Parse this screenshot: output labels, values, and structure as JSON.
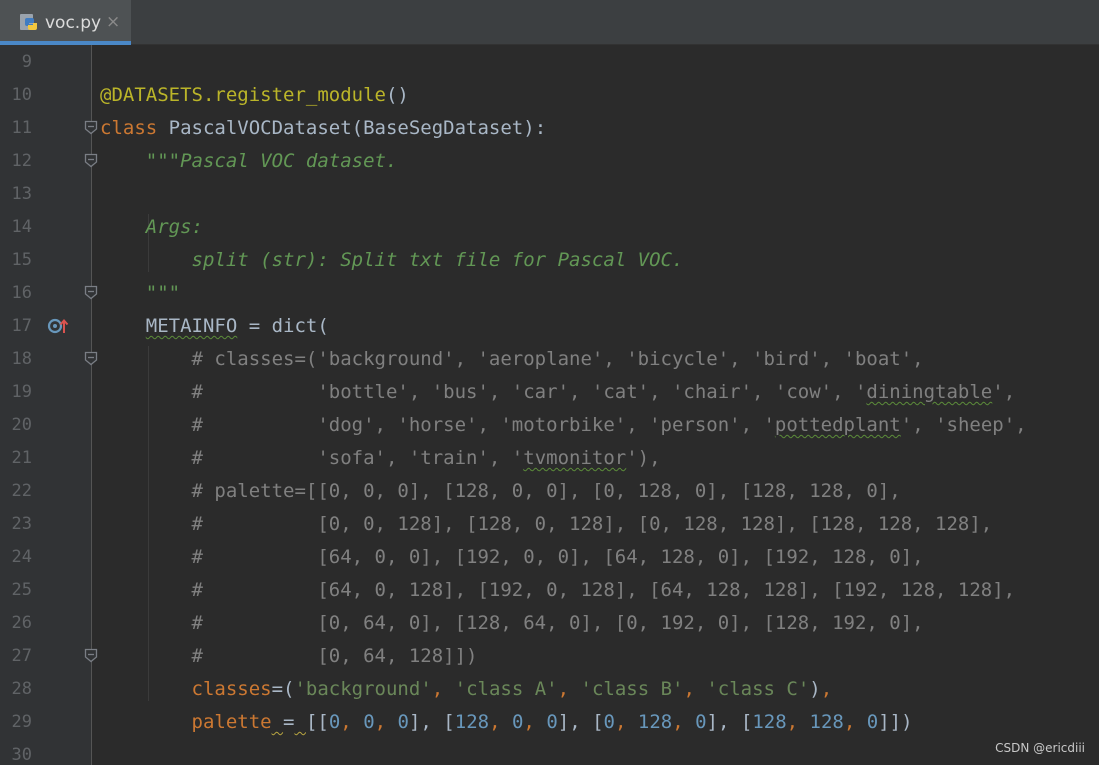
{
  "tab": {
    "title": "voc.py",
    "close_symbol": "×",
    "icon": "python-file-icon"
  },
  "watermark": "CSDN @ericdiii",
  "colors": {
    "background": "#2b2b2b",
    "gutter": "#313335",
    "keyword": "#cc7832",
    "decorator": "#bbb529",
    "docstring": "#629755",
    "comment": "#808080",
    "string": "#6a8759",
    "number": "#6897bb",
    "accent_tab_underline": "#4a88c7"
  },
  "gutter_icons": {
    "line_17": "override-implements-icon"
  },
  "lines": [
    {
      "num": "9",
      "fold": false,
      "tokens": []
    },
    {
      "num": "10",
      "fold": false,
      "tokens": [
        {
          "t": "@DATASETS.register_module",
          "c": "dec"
        },
        {
          "t": "()",
          "c": "plain"
        }
      ]
    },
    {
      "num": "11",
      "fold": true,
      "tokens": [
        {
          "t": "class ",
          "c": "kw"
        },
        {
          "t": "PascalVOCDataset(BaseSegDataset):",
          "c": "plain"
        }
      ]
    },
    {
      "num": "12",
      "fold": true,
      "tokens": [
        {
          "t": "    ",
          "c": "plain"
        },
        {
          "t": "\"\"\"Pascal VOC dataset.",
          "c": "doc"
        }
      ]
    },
    {
      "num": "13",
      "fold": false,
      "tokens": []
    },
    {
      "num": "14",
      "fold": false,
      "tokens": [
        {
          "t": "    ",
          "c": "plain"
        },
        {
          "t": "Args:",
          "c": "doc"
        }
      ]
    },
    {
      "num": "15",
      "fold": false,
      "tokens": [
        {
          "t": "        ",
          "c": "plain"
        },
        {
          "t": "split (str): Split txt file for Pascal VOC.",
          "c": "doc"
        }
      ]
    },
    {
      "num": "16",
      "fold": true,
      "tokens": [
        {
          "t": "    ",
          "c": "plain"
        },
        {
          "t": "\"\"\"",
          "c": "doc"
        }
      ]
    },
    {
      "num": "17",
      "fold": false,
      "mark": true,
      "tokens": [
        {
          "t": "    ",
          "c": "plain"
        },
        {
          "t": "METAINFO",
          "c": "plain",
          "sq": "green"
        },
        {
          "t": " = dict(",
          "c": "plain"
        }
      ]
    },
    {
      "num": "18",
      "fold": true,
      "tokens": [
        {
          "t": "        ",
          "c": "plain"
        },
        {
          "t": "# classes=('background', 'aeroplane', 'bicycle', 'bird', 'boat',",
          "c": "cm"
        }
      ]
    },
    {
      "num": "19",
      "fold": false,
      "tokens": [
        {
          "t": "        ",
          "c": "plain"
        },
        {
          "t": "#          'bottle', 'bus', 'car', 'cat', 'chair', 'cow', '",
          "c": "cm"
        },
        {
          "t": "diningtable",
          "c": "cm",
          "sq": "green"
        },
        {
          "t": "',",
          "c": "cm"
        }
      ]
    },
    {
      "num": "20",
      "fold": false,
      "tokens": [
        {
          "t": "        ",
          "c": "plain"
        },
        {
          "t": "#          'dog', 'horse', 'motorbike', 'person', '",
          "c": "cm"
        },
        {
          "t": "pottedplant",
          "c": "cm",
          "sq": "green"
        },
        {
          "t": "', 'sheep',",
          "c": "cm"
        }
      ]
    },
    {
      "num": "21",
      "fold": false,
      "tokens": [
        {
          "t": "        ",
          "c": "plain"
        },
        {
          "t": "#          'sofa', 'train', '",
          "c": "cm"
        },
        {
          "t": "tvmonitor",
          "c": "cm",
          "sq": "green"
        },
        {
          "t": "'),",
          "c": "cm"
        }
      ]
    },
    {
      "num": "22",
      "fold": false,
      "tokens": [
        {
          "t": "        ",
          "c": "plain"
        },
        {
          "t": "# palette=[[0, 0, 0], [128, 0, 0], [0, 128, 0], [128, 128, 0],",
          "c": "cm"
        }
      ]
    },
    {
      "num": "23",
      "fold": false,
      "tokens": [
        {
          "t": "        ",
          "c": "plain"
        },
        {
          "t": "#          [0, 0, 128], [128, 0, 128], [0, 128, 128], [128, 128, 128],",
          "c": "cm"
        }
      ]
    },
    {
      "num": "24",
      "fold": false,
      "tokens": [
        {
          "t": "        ",
          "c": "plain"
        },
        {
          "t": "#          [64, 0, 0], [192, 0, 0], [64, 128, 0], [192, 128, 0],",
          "c": "cm"
        }
      ]
    },
    {
      "num": "25",
      "fold": false,
      "tokens": [
        {
          "t": "        ",
          "c": "plain"
        },
        {
          "t": "#          [64, 0, 128], [192, 0, 128], [64, 128, 128], [192, 128, 128],",
          "c": "cm"
        }
      ]
    },
    {
      "num": "26",
      "fold": false,
      "tokens": [
        {
          "t": "        ",
          "c": "plain"
        },
        {
          "t": "#          [0, 64, 0], [128, 64, 0], [0, 192, 0], [128, 192, 0],",
          "c": "cm"
        }
      ]
    },
    {
      "num": "27",
      "fold": true,
      "tokens": [
        {
          "t": "        ",
          "c": "plain"
        },
        {
          "t": "#          [0, 64, 128]])",
          "c": "cm"
        }
      ]
    },
    {
      "num": "28",
      "fold": false,
      "tokens": [
        {
          "t": "        ",
          "c": "plain"
        },
        {
          "t": "classes",
          "c": "kw"
        },
        {
          "t": "=(",
          "c": "plain"
        },
        {
          "t": "'background'",
          "c": "str"
        },
        {
          "t": ", ",
          "c": "kw"
        },
        {
          "t": "'class A'",
          "c": "str"
        },
        {
          "t": ", ",
          "c": "kw"
        },
        {
          "t": "'class B'",
          "c": "str"
        },
        {
          "t": ", ",
          "c": "kw"
        },
        {
          "t": "'class C'",
          "c": "str"
        },
        {
          "t": ")",
          "c": "plain"
        },
        {
          "t": ",",
          "c": "kw"
        }
      ]
    },
    {
      "num": "29",
      "fold": false,
      "tokens": [
        {
          "t": "        ",
          "c": "plain"
        },
        {
          "t": "palette",
          "c": "kw"
        },
        {
          "t": " ",
          "c": "plain",
          "sq": "yellow"
        },
        {
          "t": "=",
          "c": "plain"
        },
        {
          "t": " ",
          "c": "plain",
          "sq": "yellow"
        },
        {
          "t": "[[",
          "c": "plain"
        },
        {
          "t": "0",
          "c": "num"
        },
        {
          "t": ", ",
          "c": "kw"
        },
        {
          "t": "0",
          "c": "num"
        },
        {
          "t": ", ",
          "c": "kw"
        },
        {
          "t": "0",
          "c": "num"
        },
        {
          "t": "], [",
          "c": "plain"
        },
        {
          "t": "128",
          "c": "num"
        },
        {
          "t": ", ",
          "c": "kw"
        },
        {
          "t": "0",
          "c": "num"
        },
        {
          "t": ", ",
          "c": "kw"
        },
        {
          "t": "0",
          "c": "num"
        },
        {
          "t": "], [",
          "c": "plain"
        },
        {
          "t": "0",
          "c": "num"
        },
        {
          "t": ", ",
          "c": "kw"
        },
        {
          "t": "128",
          "c": "num"
        },
        {
          "t": ", ",
          "c": "kw"
        },
        {
          "t": "0",
          "c": "num"
        },
        {
          "t": "], [",
          "c": "plain"
        },
        {
          "t": "128",
          "c": "num"
        },
        {
          "t": ", ",
          "c": "kw"
        },
        {
          "t": "128",
          "c": "num"
        },
        {
          "t": ", ",
          "c": "kw"
        },
        {
          "t": "0",
          "c": "num"
        },
        {
          "t": "]])",
          "c": "plain"
        }
      ]
    },
    {
      "num": "30",
      "fold": false,
      "tokens": []
    }
  ]
}
